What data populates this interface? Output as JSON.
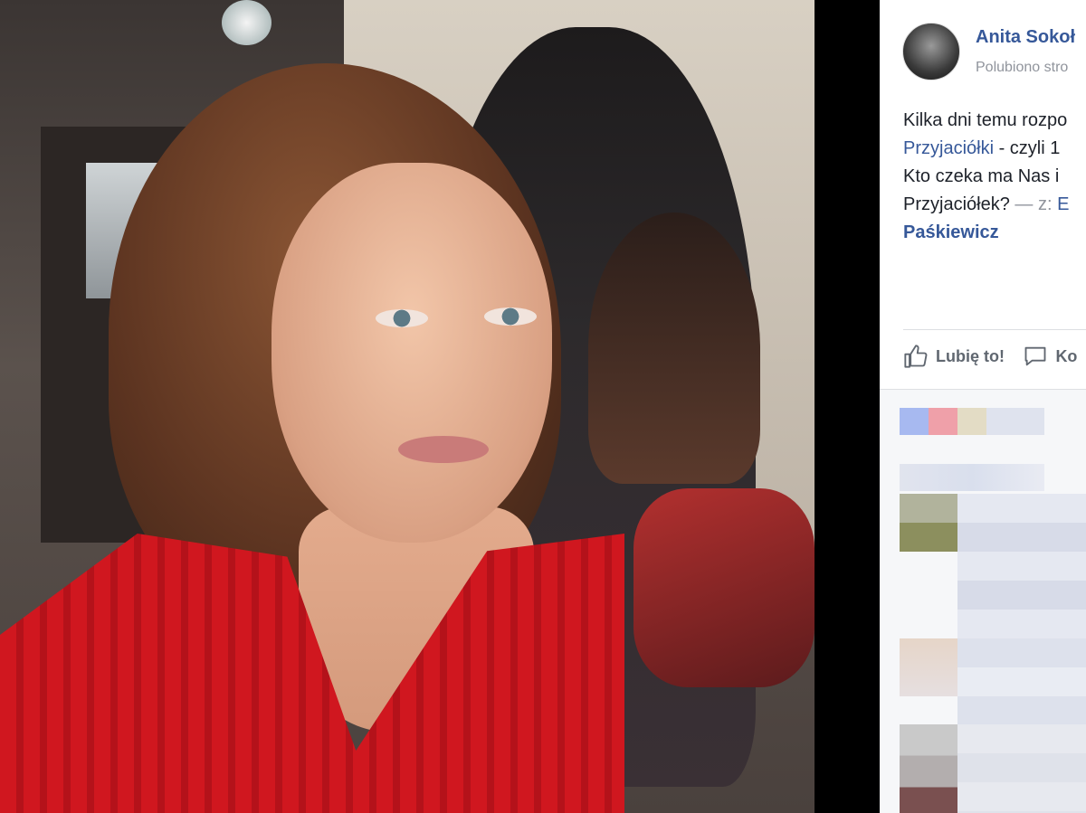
{
  "post": {
    "author": "Anita Sokoł",
    "subline": "Polubiono stro",
    "text": {
      "line1": "Kilka dni temu rozpo",
      "line2_link": "Przyjaciółki",
      "line2_rest": " - czyli 1",
      "line3": "Kto czeka ma Nas i",
      "line4_text": "Przyjaciółek?",
      "line4_with": " — z: ",
      "line4_tag": "E",
      "line5_tag": "Paśkiewicz"
    }
  },
  "actions": {
    "like_label": "Lubię to!",
    "comment_label": "Ko"
  },
  "icons": {
    "like": "thumbs-up-icon",
    "comment": "speech-bubble-icon"
  },
  "colors": {
    "link": "#365899",
    "muted": "#90949c",
    "text": "#1d2129",
    "sweater": "#d0171f"
  }
}
